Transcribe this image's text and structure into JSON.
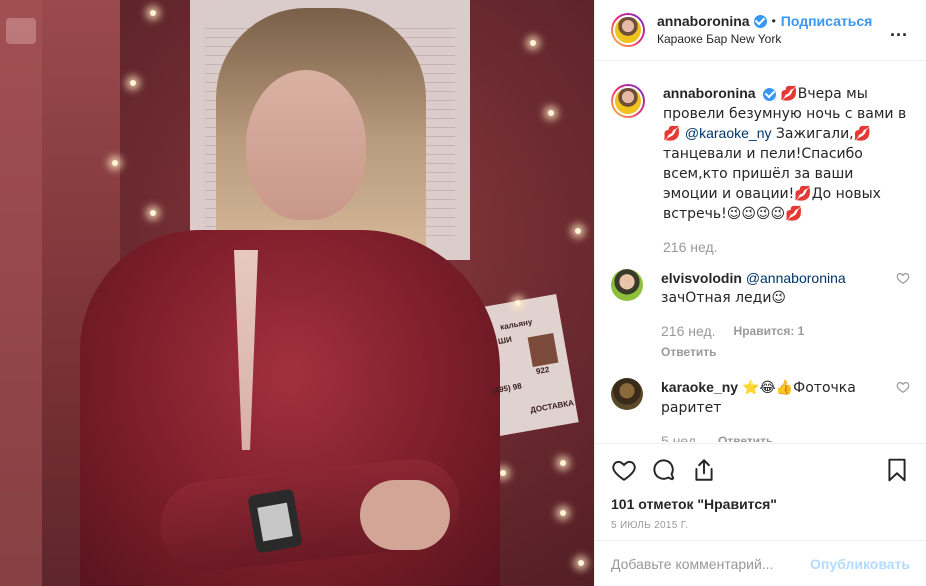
{
  "header": {
    "username": "annaboronina",
    "follow_label": "Подписаться",
    "separator": "•",
    "location": "Караоке Бар New York",
    "more_label": "..."
  },
  "photo": {
    "sign_text": [
      "кальяну",
      "ШИ",
      "922",
      "(495) 98",
      "ДОСТАВКА"
    ]
  },
  "caption": {
    "username": "annaboronina",
    "text_before": "💋Вчера мы провели безумную ночь с вами в💋 ",
    "mention": "@karaoke_ny",
    "text_after": " Зажигали,💋танцевали и пели!Спасибо всем,кто пришёл за ваши эмоции и овации!💋До новых встречь!😉😉😉😉💋",
    "age": "216 нед."
  },
  "comments": [
    {
      "username": "elvisvolodin",
      "mention": "@annaboronina",
      "text": "зачОтная леди😉",
      "age": "216 нед.",
      "likes": "Нравится: 1",
      "reply_label": "Ответить"
    },
    {
      "username": "karaoke_ny",
      "text": "⭐😂👍Фоточка раритет",
      "age": "5 нед.",
      "reply_label": "Ответить"
    }
  ],
  "actions": {
    "likes_count": "101 отметок \"Нравится\"",
    "date": "5 июль 2015 г."
  },
  "add_comment": {
    "placeholder": "Добавьте комментарий...",
    "publish_label": "Опубликовать"
  },
  "colors": {
    "accent": "#3897f0",
    "publish_disabled": "#b3dbff",
    "muted": "#999999"
  }
}
